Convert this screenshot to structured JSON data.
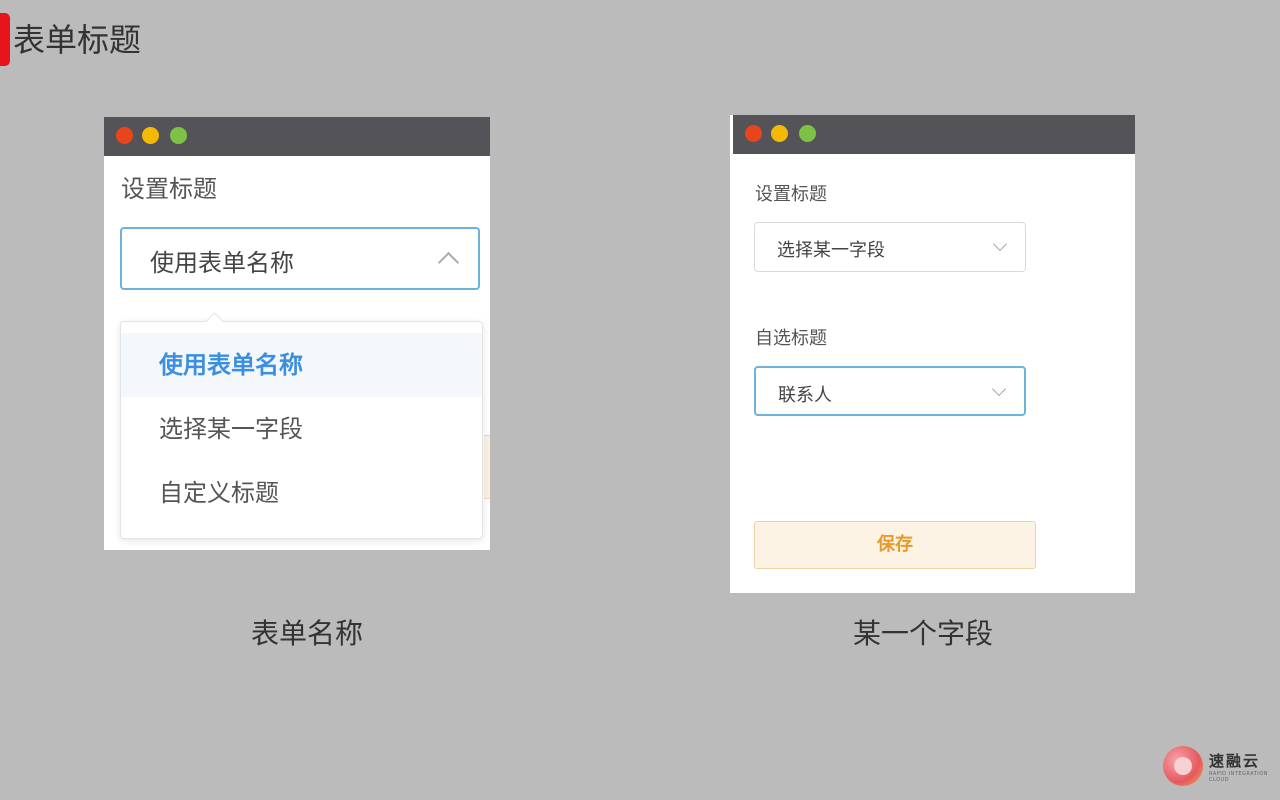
{
  "slide": {
    "title": "表单标题"
  },
  "left_window": {
    "label": "设置标题",
    "select_value": "使用表单名称",
    "options": [
      "使用表单名称",
      "选择某一字段",
      "自定义标题"
    ],
    "selected_option": "使用表单名称",
    "caption": "表单名称"
  },
  "right_window": {
    "label_1": "设置标题",
    "select_1_value": "选择某一字段",
    "label_2": "自选标题",
    "select_2_value": "联系人",
    "save_label": "保存",
    "caption": "某一个字段"
  },
  "logo": {
    "text": "速融云",
    "subtext": "RAPID INTEGRATION CLOUD"
  },
  "colors": {
    "accent_red": "#e8131b",
    "link_blue": "#3b8fe0",
    "save_orange": "#e59a2a",
    "titlebar": "#545358"
  }
}
